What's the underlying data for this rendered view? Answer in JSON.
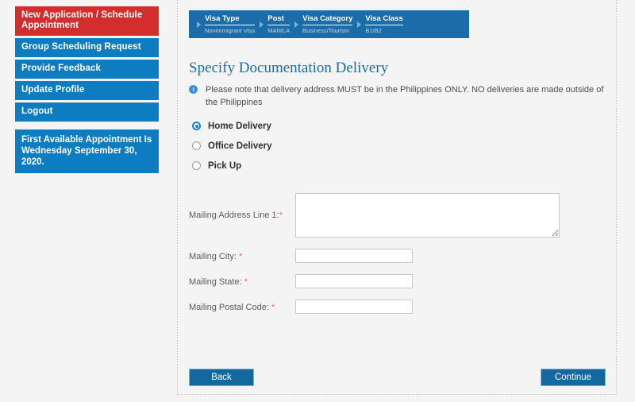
{
  "sidebar": {
    "nav_items": [
      {
        "label": "New Application / Schedule Appointment",
        "style": "red",
        "name": "new-application"
      },
      {
        "label": "Group Scheduling Request",
        "style": "blue",
        "name": "group-scheduling"
      },
      {
        "label": "Provide Feedback",
        "style": "blue",
        "name": "provide-feedback"
      },
      {
        "label": "Update Profile",
        "style": "blue",
        "name": "update-profile"
      },
      {
        "label": "Logout",
        "style": "blue",
        "name": "logout"
      }
    ],
    "availability": {
      "line1": "First Available Appointment Is",
      "line2": "Wednesday September 30, 2020."
    }
  },
  "breadcrumb": {
    "steps": [
      {
        "label": "Visa Type",
        "value": "Nonimmigrant Visa"
      },
      {
        "label": "Post",
        "value": "MANILA"
      },
      {
        "label": "Visa Category",
        "value": "Business/Tourism"
      },
      {
        "label": "Visa Class",
        "value": "B1/B2"
      }
    ]
  },
  "main": {
    "title": "Specify Documentation Delivery",
    "info_icon": "info-icon",
    "info_text": "Please note that delivery address MUST be in the Philippines ONLY.  NO deliveries are made outside of the Philippines",
    "delivery_options": [
      {
        "label": "Home Delivery",
        "selected": true,
        "name": "home-delivery"
      },
      {
        "label": "Office Delivery",
        "selected": false,
        "name": "office-delivery"
      },
      {
        "label": "Pick Up",
        "selected": false,
        "name": "pick-up"
      }
    ],
    "fields": [
      {
        "label": "Mailing Address Line 1:",
        "required_mark": "*",
        "space_before_mark": false,
        "type": "textarea",
        "value": "",
        "placeholder": "",
        "name": "mailing-address-line-1"
      },
      {
        "label": "Mailing City:",
        "required_mark": "*",
        "space_before_mark": true,
        "type": "text",
        "value": "",
        "placeholder": "",
        "name": "mailing-city"
      },
      {
        "label": "Mailing State:",
        "required_mark": "*",
        "space_before_mark": true,
        "type": "text",
        "value": "",
        "placeholder": "",
        "name": "mailing-state"
      },
      {
        "label": "Mailing Postal Code:",
        "required_mark": "*",
        "space_before_mark": true,
        "type": "text",
        "value": "",
        "placeholder": "",
        "name": "mailing-postal-code"
      }
    ],
    "back_label": "Back",
    "continue_label": "Continue"
  },
  "colors": {
    "accent_blue": "#0d7cc1",
    "breadcrumb_blue": "#1b6ca8",
    "active_red": "#d32d2d",
    "button_blue": "#1368a0",
    "required_red": "#f06a5a",
    "title_blue": "#1c6ca4",
    "page_bg": "#f4f4f4"
  }
}
